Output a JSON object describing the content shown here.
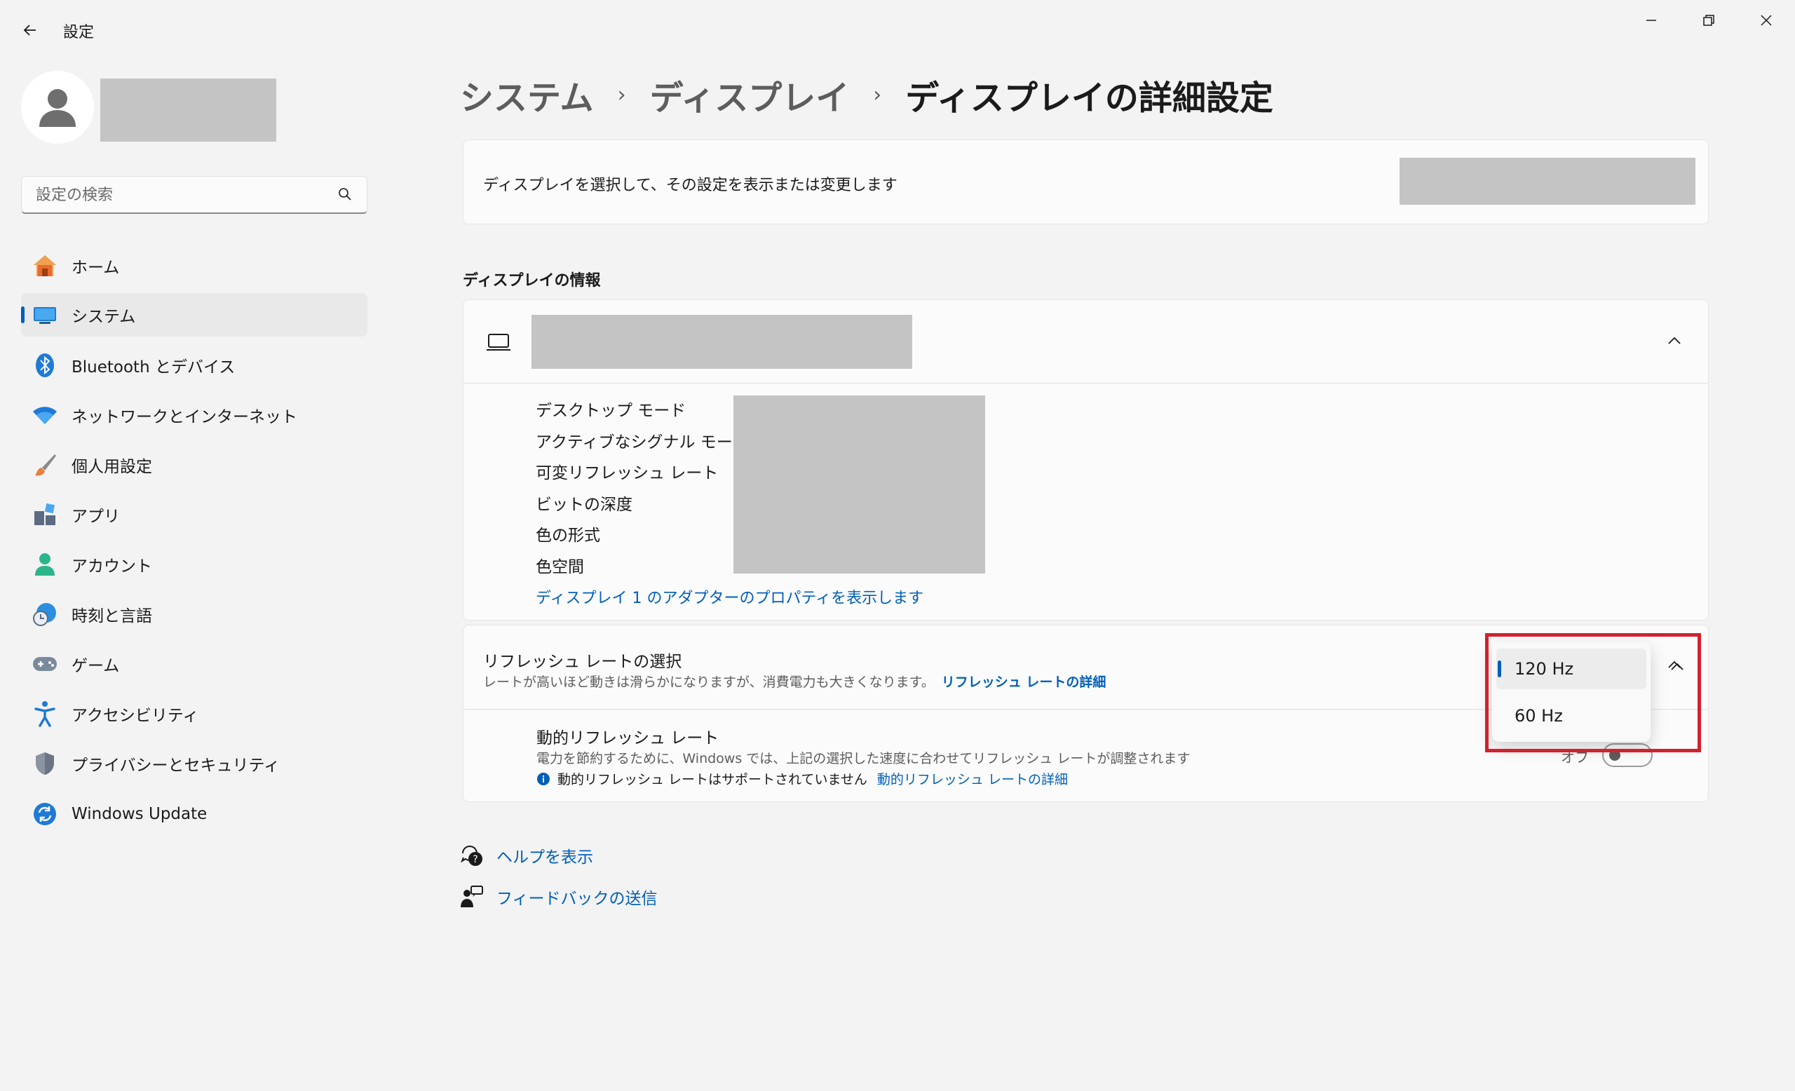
{
  "window": {
    "title": "設定"
  },
  "search": {
    "placeholder": "設定の検索"
  },
  "sidebar": {
    "items": [
      {
        "label": "ホーム",
        "icon": "home-icon"
      },
      {
        "label": "システム",
        "icon": "system-icon",
        "active": true
      },
      {
        "label": "Bluetooth とデバイス",
        "icon": "bluetooth-icon"
      },
      {
        "label": "ネットワークとインターネット",
        "icon": "wifi-icon"
      },
      {
        "label": "個人用設定",
        "icon": "brush-icon"
      },
      {
        "label": "アプリ",
        "icon": "apps-icon"
      },
      {
        "label": "アカウント",
        "icon": "account-icon"
      },
      {
        "label": "時刻と言語",
        "icon": "clock-globe-icon"
      },
      {
        "label": "ゲーム",
        "icon": "gamepad-icon"
      },
      {
        "label": "アクセシビリティ",
        "icon": "accessibility-icon"
      },
      {
        "label": "プライバシーとセキュリティ",
        "icon": "shield-icon"
      },
      {
        "label": "Windows Update",
        "icon": "update-icon"
      }
    ]
  },
  "breadcrumb": {
    "level1": "システム",
    "level2": "ディスプレイ",
    "current": "ディスプレイの詳細設定"
  },
  "select_display": {
    "label": "ディスプレイを選択して、その設定を表示または変更します"
  },
  "display_info": {
    "title": "ディスプレイの情報",
    "labels": [
      "デスクトップ モード",
      "アクティブなシグナル モード",
      "可変リフレッシュ レート",
      "ビットの深度",
      "色の形式",
      "色空間"
    ],
    "adapter_link": "ディスプレイ 1 のアダプターのプロパティを表示します"
  },
  "refresh_rate": {
    "title": "リフレッシュ レートの選択",
    "description": "レートが高いほど動きは滑らかになりますが、消費電力も大きくなります。",
    "link": "リフレッシュ レートの詳細",
    "options": [
      "120 Hz",
      "60 Hz"
    ],
    "selected": "120 Hz"
  },
  "dynamic_refresh": {
    "title": "動的リフレッシュ レート",
    "description": "電力を節約するために、Windows では、上記の選択した速度に合わせてリフレッシュ レートが調整されます",
    "unsupported": "動的リフレッシュ レートはサポートされていません",
    "link": "動的リフレッシュ レートの詳細",
    "toggle_label": "オフ"
  },
  "footer": {
    "help": "ヘルプを表示",
    "feedback": "フィードバックの送信"
  },
  "colors": {
    "accent": "#005fb8",
    "highlight": "#d1222e"
  }
}
